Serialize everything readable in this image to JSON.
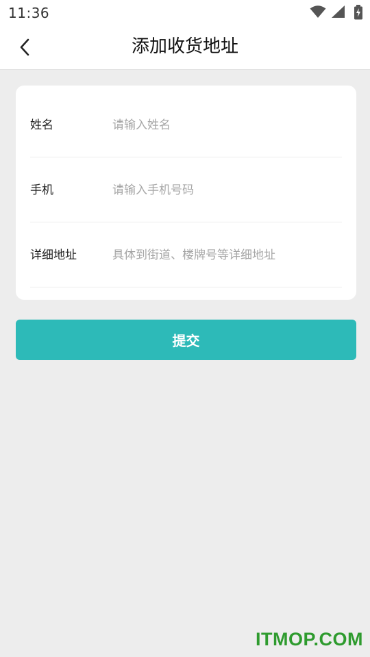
{
  "status_bar": {
    "time": "11:36",
    "icons": [
      "wifi-icon",
      "signal-icon",
      "battery-charging-icon"
    ]
  },
  "header": {
    "back_icon": "chevron-left-icon",
    "title": "添加收货地址"
  },
  "form": {
    "fields": [
      {
        "label": "姓名",
        "value": "",
        "placeholder": "请输入姓名"
      },
      {
        "label": "手机",
        "value": "",
        "placeholder": "请输入手机号码"
      },
      {
        "label": "详细地址",
        "value": "",
        "placeholder": "具体到街道、楼牌号等详细地址"
      }
    ]
  },
  "submit": {
    "label": "提交"
  },
  "watermark": {
    "text": "ITMOP.COM"
  },
  "colors": {
    "accent": "#2dbab8",
    "background": "#ededed",
    "card": "#ffffff",
    "placeholder": "#a6a6a6",
    "watermark": "#2e9b2e"
  }
}
